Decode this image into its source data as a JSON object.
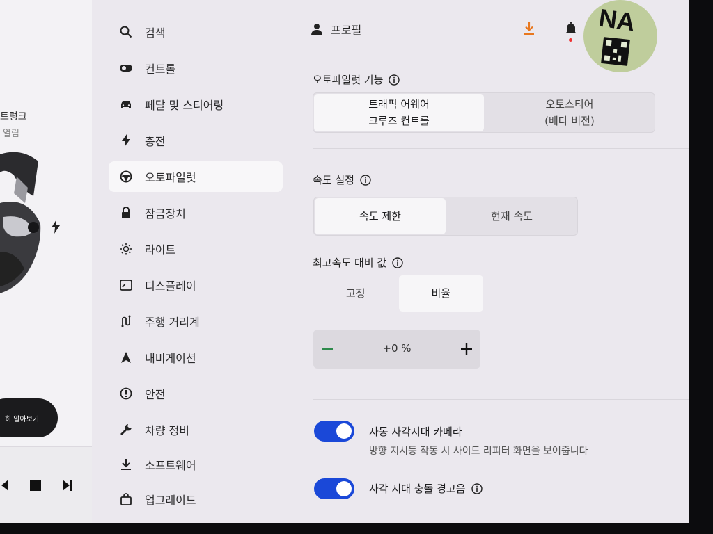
{
  "car_panel": {
    "trunk_title": "트렁크",
    "trunk_status": "열림",
    "learn_more": "히 알아보기"
  },
  "menu": {
    "active": "autopilot",
    "items": [
      {
        "id": "search",
        "label": "검색",
        "icon": "search-icon"
      },
      {
        "id": "controls",
        "label": "컨트롤",
        "icon": "toggle-icon"
      },
      {
        "id": "pedals",
        "label": "페달 및 스티어링",
        "icon": "car-icon"
      },
      {
        "id": "charging",
        "label": "충전",
        "icon": "bolt-icon"
      },
      {
        "id": "autopilot",
        "label": "오토파일럿",
        "icon": "steering-wheel-icon"
      },
      {
        "id": "locks",
        "label": "잠금장치",
        "icon": "lock-icon"
      },
      {
        "id": "lights",
        "label": "라이트",
        "icon": "sun-icon"
      },
      {
        "id": "display",
        "label": "디스플레이",
        "icon": "display-icon"
      },
      {
        "id": "trips",
        "label": "주행 거리계",
        "icon": "trip-icon"
      },
      {
        "id": "navigation",
        "label": "내비게이션",
        "icon": "navigation-arrow-icon"
      },
      {
        "id": "safety",
        "label": "안전",
        "icon": "alert-circle-icon"
      },
      {
        "id": "service",
        "label": "차량 정비",
        "icon": "wrench-icon"
      },
      {
        "id": "software",
        "label": "소프트웨어",
        "icon": "download-icon"
      },
      {
        "id": "upgrades",
        "label": "업그레이드",
        "icon": "shopping-bag-icon"
      }
    ]
  },
  "header": {
    "profile_label": "프로필",
    "download_color": "#e8771e",
    "sticker_text": "NA"
  },
  "autopilot_features": {
    "label": "오토파일럿 기능",
    "options": [
      {
        "line1": "트래픽 어웨어",
        "line2": "크루즈 컨트롤",
        "selected": true
      },
      {
        "line1": "오토스티어",
        "line2": "(베타 버전)",
        "selected": false
      }
    ]
  },
  "speed_setting": {
    "label": "속도 설정",
    "options": [
      {
        "label": "속도 제한",
        "selected": true
      },
      {
        "label": "현재 속도",
        "selected": false
      }
    ]
  },
  "offset": {
    "label": "최고속도 대비 값",
    "options": [
      {
        "label": "고정",
        "selected": false
      },
      {
        "label": "비율",
        "selected": true
      }
    ],
    "value": "+0 %"
  },
  "blindspot_camera": {
    "title": "자동 사각지대 카메라",
    "description": "방향 지시등 작동 시 사이드 리피터 화면을 보여줍니다",
    "on": true
  },
  "blindspot_chime": {
    "title": "사각 지대 충돌 경고음",
    "on": true
  },
  "colors": {
    "toggle_on": "#1a48d8",
    "accent_download": "#e8771e"
  }
}
